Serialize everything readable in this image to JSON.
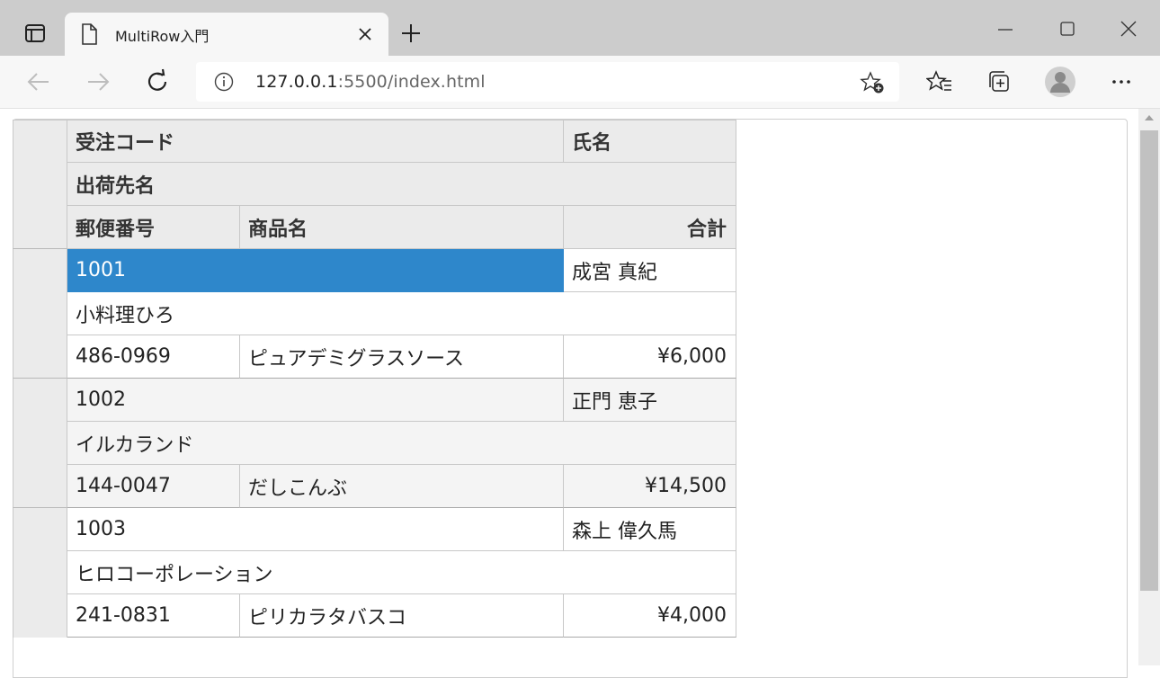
{
  "browser": {
    "tab_title": "MultiRow入門",
    "url_host": "127.0.0.1",
    "url_rest": ":5500/index.html"
  },
  "grid": {
    "headers": {
      "order_code": "受注コード",
      "customer": "氏名",
      "ship_to": "出荷先名",
      "zip": "郵便番号",
      "product": "商品名",
      "total": "合計"
    },
    "records": [
      {
        "order_code": "1001",
        "customer": "成宮 真紀",
        "ship_to": "小料理ひろ",
        "zip": "486-0969",
        "product": "ピュアデミグラスソース",
        "total": "¥6,000"
      },
      {
        "order_code": "1002",
        "customer": "正門 恵子",
        "ship_to": "イルカランド",
        "zip": "144-0047",
        "product": "だしこんぶ",
        "total": "¥14,500"
      },
      {
        "order_code": "1003",
        "customer": "森上 偉久馬",
        "ship_to": "ヒロコーポレーション",
        "zip": "241-0831",
        "product": "ピリカラタバスコ",
        "total": "¥4,000"
      }
    ]
  },
  "colors": {
    "selected": "#2e87cb",
    "header_bg": "#ebebeb",
    "alt_row": "#f4f4f4"
  }
}
